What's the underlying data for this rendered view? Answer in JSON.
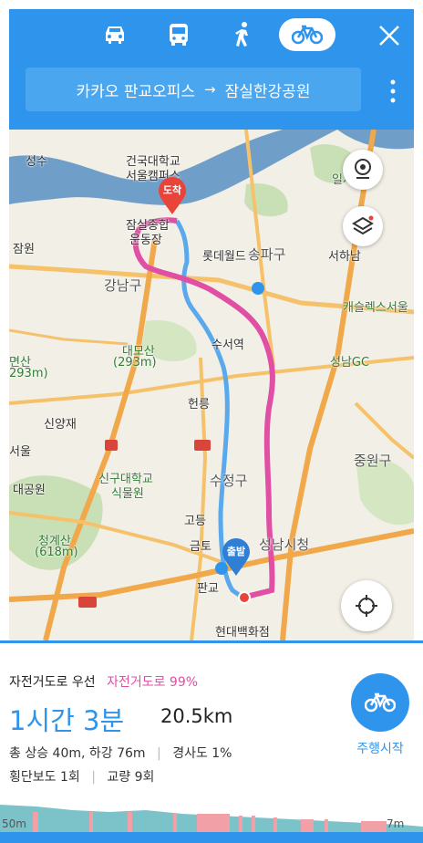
{
  "header": {
    "modes": [
      {
        "name": "car",
        "icon": "car-icon"
      },
      {
        "name": "bus",
        "icon": "bus-icon"
      },
      {
        "name": "walk",
        "icon": "walk-icon"
      },
      {
        "name": "bike",
        "icon": "bike-icon",
        "active": true
      }
    ],
    "route": {
      "origin": "카카오 판교오피스",
      "arrow": "→",
      "destination": "잠실한강공원"
    },
    "accent": "#2f95ec"
  },
  "map": {
    "labels": {
      "l1": "건국대학교",
      "l2": "서울캠퍼스",
      "l3": "잠실종합",
      "l4": "운동장",
      "l5": "롯데월드",
      "l6": "송파구",
      "l7": "강남구",
      "l8": "수서역",
      "l9": "대모산",
      "l10": "(293m)",
      "l11": "신양재",
      "l12": "헌릉",
      "l13": "신구대학교",
      "l14": "식물원",
      "l15": "수정구",
      "l16": "청계산",
      "l17": "(618m)",
      "l18": "성남시청",
      "l19": "현대백화점",
      "l20": "일자산",
      "l21": "서하남",
      "l22": "캐슬렉스서울",
      "l23": "성남GC",
      "l24": "중원구",
      "l25": "잠원",
      "l26": "성수",
      "l27": "도착",
      "l28": "출발",
      "l29": "대공원",
      "l30": "금토",
      "l31": "판교",
      "l32": "고등",
      "l33": "면산",
      "l34": "293m)",
      "l35": "서울"
    }
  },
  "panel": {
    "preference": "자전거도로 우선",
    "preference_pct": "자전거도로 99%",
    "duration": "1시간 3분",
    "distance": "20.5km",
    "elevation": "총 상승 40m, 하강 76m",
    "slope": "경사도 1%",
    "crossings": "횡단보도 1회",
    "bridges": "교량 9회",
    "start_label": "주행시작",
    "profile_left": "50m",
    "profile_right": "7m",
    "route_color": "#e04fa3"
  }
}
